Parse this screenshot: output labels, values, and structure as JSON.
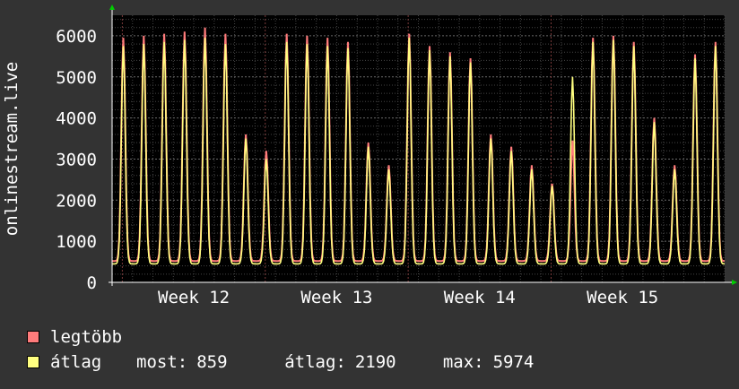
{
  "colors": {
    "background": "#333333",
    "plot_background": "#000000",
    "grid": "#555555",
    "axis": "#ffffff",
    "arrow": "#00cc00",
    "max_series": "#ff7b7b",
    "avg_series": "#ffff80"
  },
  "chart_data": {
    "type": "area",
    "ylabel": "onlinestream.live",
    "ylim": [
      0,
      6500
    ],
    "yticks": [
      0,
      1000,
      2000,
      3000,
      4000,
      5000,
      6000
    ],
    "xlim": [
      0,
      30
    ],
    "xticks": [
      {
        "label": "Week 12",
        "x": 4
      },
      {
        "label": "Week 13",
        "x": 11
      },
      {
        "label": "Week 14",
        "x": 18
      },
      {
        "label": "Week 15",
        "x": 25
      }
    ],
    "grid": true,
    "series": [
      {
        "name": "legtöbb",
        "color": "#ff7b7b",
        "peaks": [
          5950,
          6000,
          6050,
          6100,
          6200,
          6050,
          3600,
          3200,
          6100,
          6050,
          6000,
          5950,
          5850,
          3400,
          2850,
          6050,
          5750,
          5600,
          5450,
          3600,
          3300,
          2850,
          2400,
          3450,
          5700,
          5950,
          6000,
          5850,
          4000,
          2850,
          5550,
          5850
        ]
      },
      {
        "name": "átlag",
        "color": "#ffff80",
        "peaks": [
          5750,
          5800,
          5850,
          5900,
          5950,
          5800,
          3500,
          3000,
          5900,
          5850,
          5800,
          5750,
          5700,
          3300,
          2750,
          5950,
          5650,
          5500,
          5350,
          3500,
          3200,
          2750,
          2350,
          5000,
          5600,
          5850,
          5900,
          5750,
          3900,
          2750,
          5450,
          5750
        ]
      }
    ],
    "legend_position": "bottom-left"
  },
  "legend": {
    "max_label": "legtöbb",
    "avg_label": "átlag"
  },
  "stats": {
    "now_label": "most:",
    "now_value": "859",
    "avg_label": "átlag:",
    "avg_value": "2190",
    "max_label": "max:",
    "max_value": "5974"
  }
}
